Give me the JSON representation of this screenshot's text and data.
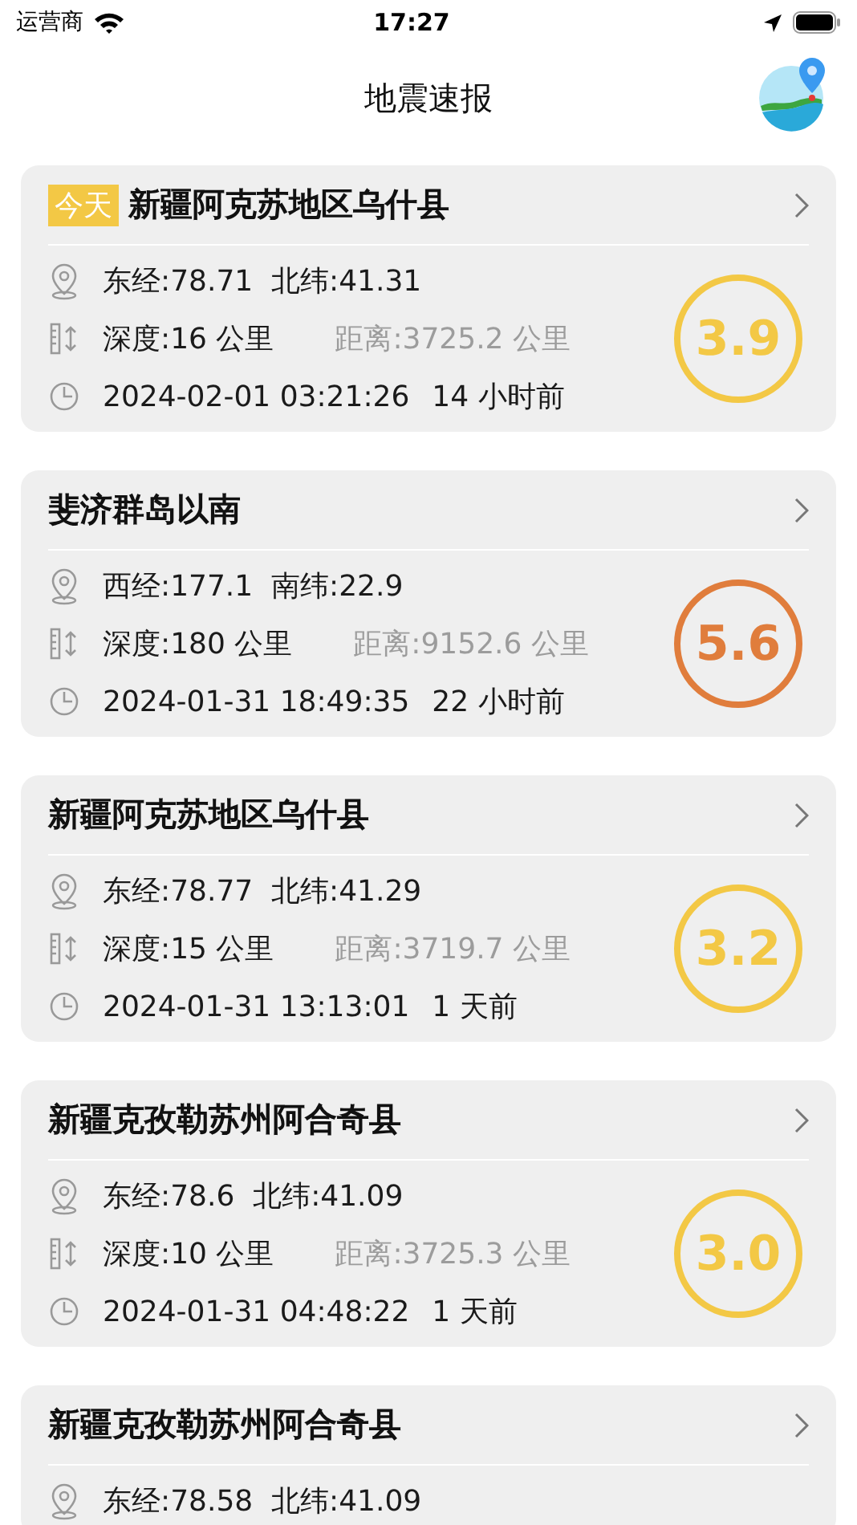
{
  "status_bar": {
    "carrier": "运营商",
    "time": "17:27"
  },
  "header": {
    "title": "地震速报"
  },
  "quakes": [
    {
      "tag": "今天",
      "title": "新疆阿克苏地区乌什县",
      "coords": "东经:78.71  北纬:41.31",
      "depth": "深度:16 公里",
      "distance": "距离:3725.2 公里",
      "time": "2024-02-01 03:21:26",
      "ago": "14 小时前",
      "magnitude": "3.9",
      "color": "#f3c845"
    },
    {
      "title": "斐济群岛以南",
      "coords": "西经:177.1  南纬:22.9",
      "depth": "深度:180 公里",
      "distance": "距离:9152.6 公里",
      "time": "2024-01-31 18:49:35",
      "ago": "22 小时前",
      "magnitude": "5.6",
      "color": "#e07d3c"
    },
    {
      "title": "新疆阿克苏地区乌什县",
      "coords": "东经:78.77  北纬:41.29",
      "depth": "深度:15 公里",
      "distance": "距离:3719.7 公里",
      "time": "2024-01-31 13:13:01",
      "ago": "1 天前",
      "magnitude": "3.2",
      "color": "#f3c845"
    },
    {
      "title": "新疆克孜勒苏州阿合奇县",
      "coords": "东经:78.6  北纬:41.09",
      "depth": "深度:10 公里",
      "distance": "距离:3725.3 公里",
      "time": "2024-01-31 04:48:22",
      "ago": "1 天前",
      "magnitude": "3.0",
      "color": "#f3c845"
    },
    {
      "title": "新疆克孜勒苏州阿合奇县",
      "coords": "东经:78.58  北纬:41.09"
    }
  ]
}
